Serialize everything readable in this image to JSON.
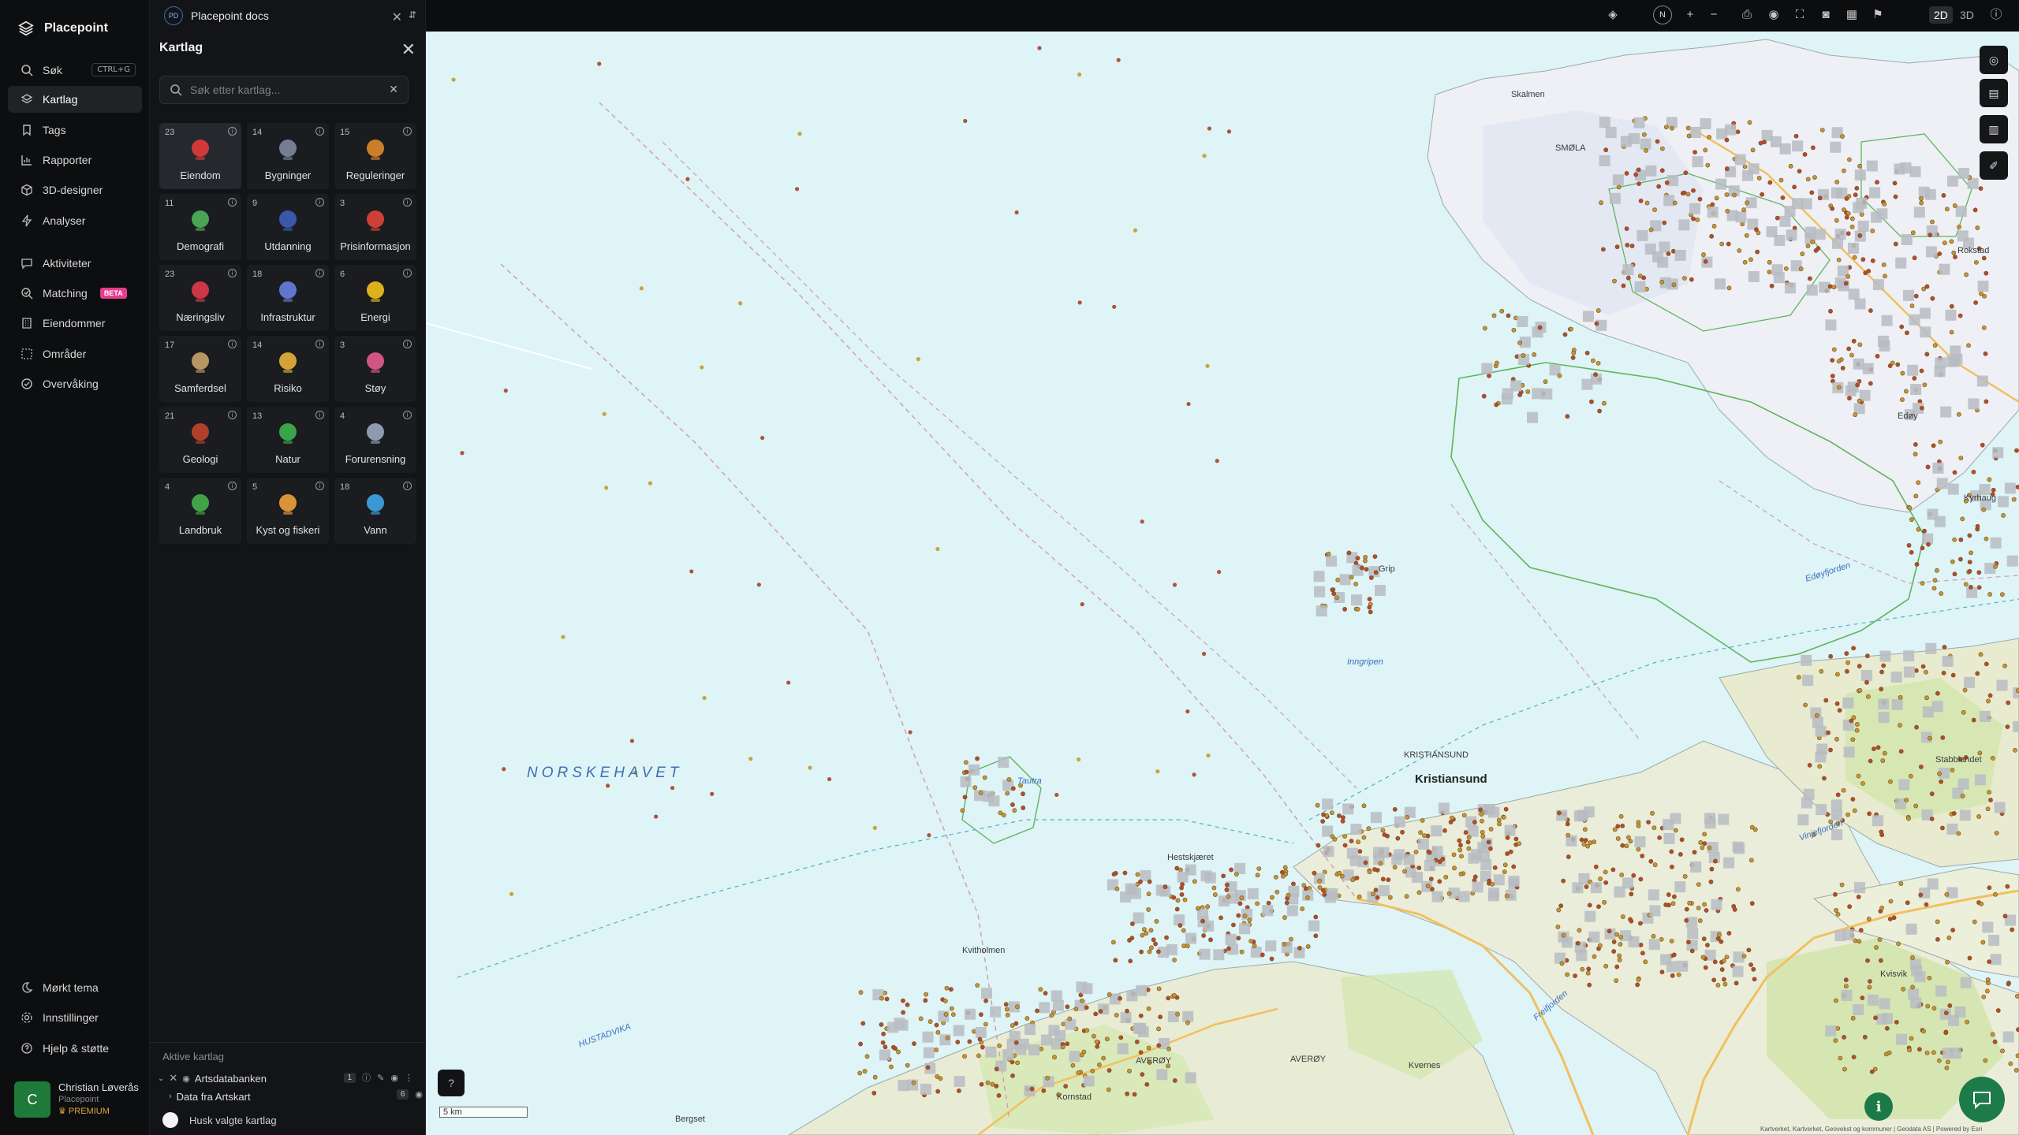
{
  "brand": {
    "name": "Placepoint"
  },
  "nav": {
    "items": [
      {
        "label": "Søk",
        "shortcut": "CTRL+G",
        "icon": "search-icon"
      },
      {
        "label": "Kartlag",
        "icon": "layers-icon",
        "active": true
      },
      {
        "label": "Tags",
        "icon": "bookmark-icon"
      },
      {
        "label": "Rapporter",
        "icon": "chart-icon"
      },
      {
        "label": "3D-designer",
        "icon": "cube-icon"
      },
      {
        "label": "Analyser",
        "icon": "bolt-icon"
      },
      {
        "label": "Aktiviteter",
        "icon": "chat-icon"
      },
      {
        "label": "Matching",
        "badge": "BETA",
        "icon": "match-icon"
      },
      {
        "label": "Eiendommer",
        "icon": "building-icon"
      },
      {
        "label": "Områder",
        "icon": "area-icon"
      },
      {
        "label": "Overvåking",
        "icon": "monitor-icon"
      }
    ],
    "bottom": [
      {
        "label": "Mørkt tema",
        "icon": "moon-icon"
      },
      {
        "label": "Innstillinger",
        "icon": "gear-icon"
      },
      {
        "label": "Hjelp & støtte",
        "icon": "help-icon"
      }
    ],
    "user": {
      "initial": "C",
      "name": "Christian Løverås",
      "org": "Placepoint",
      "plan": "PREMIUM"
    }
  },
  "doc": {
    "badge": "PD",
    "title": "Placepoint docs"
  },
  "panel": {
    "title": "Kartlag",
    "search_placeholder": "Søk etter kartlag...",
    "categories": [
      {
        "count": "23",
        "label": "Eiendom",
        "icon": "pin-icon",
        "color": "#e23b3b",
        "active": true
      },
      {
        "count": "14",
        "label": "Bygninger",
        "icon": "building-icon",
        "color": "#7d8aa0"
      },
      {
        "count": "15",
        "label": "Reguleringer",
        "icon": "signpost-icon",
        "color": "#e0892e"
      },
      {
        "count": "11",
        "label": "Demografi",
        "icon": "age-icon",
        "color": "#4fb55a"
      },
      {
        "count": "9",
        "label": "Utdanning",
        "icon": "graduation-icon",
        "color": "#3d5fb8"
      },
      {
        "count": "3",
        "label": "Prisinformasjon",
        "icon": "price-icon",
        "color": "#e0453a"
      },
      {
        "count": "23",
        "label": "Næringsliv",
        "icon": "shopping-icon",
        "color": "#e03a4b"
      },
      {
        "count": "18",
        "label": "Infrastruktur",
        "icon": "globe-icon",
        "color": "#6a7fe0"
      },
      {
        "count": "6",
        "label": "Energi",
        "icon": "lightning-icon",
        "color": "#f2c21b"
      },
      {
        "count": "17",
        "label": "Samferdsel",
        "icon": "train-icon",
        "color": "#c9a46a"
      },
      {
        "count": "14",
        "label": "Risiko",
        "icon": "warning-icon",
        "color": "#e7b43a"
      },
      {
        "count": "3",
        "label": "Støy",
        "icon": "gauge-icon",
        "color": "#e45c8e"
      },
      {
        "count": "21",
        "label": "Geologi",
        "icon": "terrain-icon",
        "color": "#c2452c"
      },
      {
        "count": "13",
        "label": "Natur",
        "icon": "leaf-icon",
        "color": "#3fb24c"
      },
      {
        "count": "4",
        "label": "Forurensning",
        "icon": "factory-icon",
        "color": "#9aa9bf"
      },
      {
        "count": "4",
        "label": "Landbruk",
        "icon": "sprout-icon",
        "color": "#46b34a"
      },
      {
        "count": "5",
        "label": "Kyst og fiskeri",
        "icon": "fish-icon",
        "color": "#f0a23a"
      },
      {
        "count": "18",
        "label": "Vann",
        "icon": "water-drop-icon",
        "color": "#3ea7e8"
      }
    ],
    "active_title": "Aktive kartlag",
    "active_layers": [
      {
        "label": "Artsdatabanken",
        "badge": "1"
      },
      {
        "label": "Data fra Artskart",
        "badge": "6"
      }
    ],
    "remember_label": "Husk valgte kartlag"
  },
  "toolbar": {
    "compass": "N",
    "zoom_in": "+",
    "zoom_out": "−",
    "mode_2d": "2D",
    "mode_3d": "3D"
  },
  "map": {
    "labels": {
      "sea": "NORSKEHAVET",
      "town": "Kristiansund",
      "town_caps": "KRISTIANSUND",
      "smola": "SMØLA",
      "averoy": "AVERØY",
      "hustadvika": "HUSTADVIKA",
      "edoyfjorden": "Edøyfjorden",
      "tautra": "Tautra",
      "kvitholmen": "Kvitholmen",
      "hestskjaeret": "Hestskjæret",
      "grip": "Grip",
      "inngripen": "Inngripen",
      "skalmen": "Skalmen",
      "vinjefjorden": "Vinjefjorden",
      "freifjorden": "Freifjorden",
      "kornstad": "Kornstad",
      "bergset": "Bergset",
      "kvernes": "Kvernes",
      "rokstad": "Rokstad",
      "kyrhaug": "Kyrhaug",
      "edoy": "Edøy",
      "stabblandet": "Stabblandet",
      "kvisvik": "Kvisvik"
    },
    "scale": "5 km",
    "attribution": "Kartverket, Kartverket, Geovekst og kommuner | Geodata AS | Powered by Esri"
  }
}
